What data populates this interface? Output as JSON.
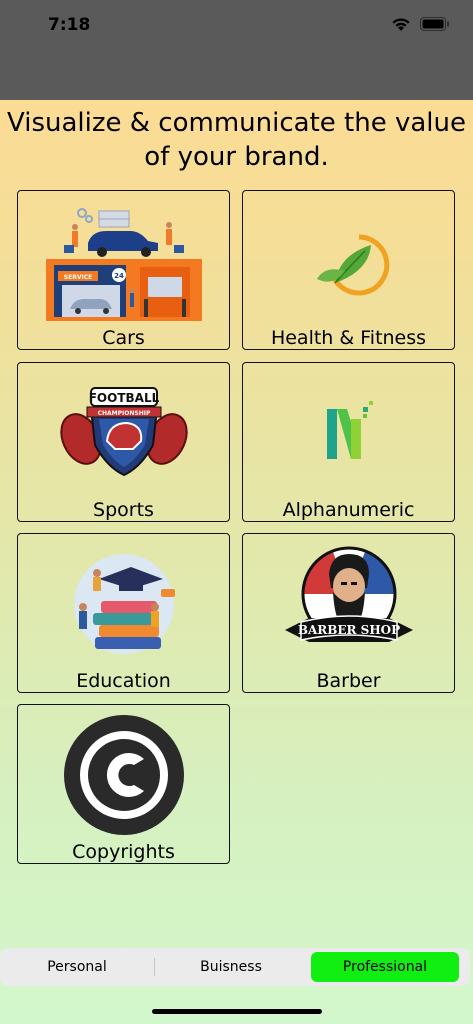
{
  "status_bar": {
    "time": "7:18"
  },
  "header": {
    "title": "Visualize & communicate the value of your brand."
  },
  "cards": [
    {
      "label": "Cars",
      "icon": "car-service-illustration"
    },
    {
      "label": "Health & Fitness",
      "icon": "leaf-logo-icon"
    },
    {
      "label": "Sports",
      "icon": "football-shield-logo"
    },
    {
      "label": "Alphanumeric",
      "icon": "letter-n-logo"
    },
    {
      "label": "Education",
      "icon": "education-books-illustration"
    },
    {
      "label": "Barber",
      "icon": "barber-shop-logo"
    },
    {
      "label": "Copyrights",
      "icon": "copyright-icon"
    }
  ],
  "barber_logo_text": "BARBER SHOP",
  "football_logo_text": {
    "top": "FOOTBALL",
    "ribbon": "CHAMPIONSHIP"
  },
  "car_sign_text": {
    "service": "SERVICE",
    "hours": "24"
  },
  "tabs": [
    {
      "label": "Personal",
      "active": false
    },
    {
      "label": "Buisness",
      "active": false
    },
    {
      "label": "Professional",
      "active": true
    }
  ],
  "colors": {
    "active_tab": "#11ee11",
    "status_bar": "#5a5a5a"
  }
}
